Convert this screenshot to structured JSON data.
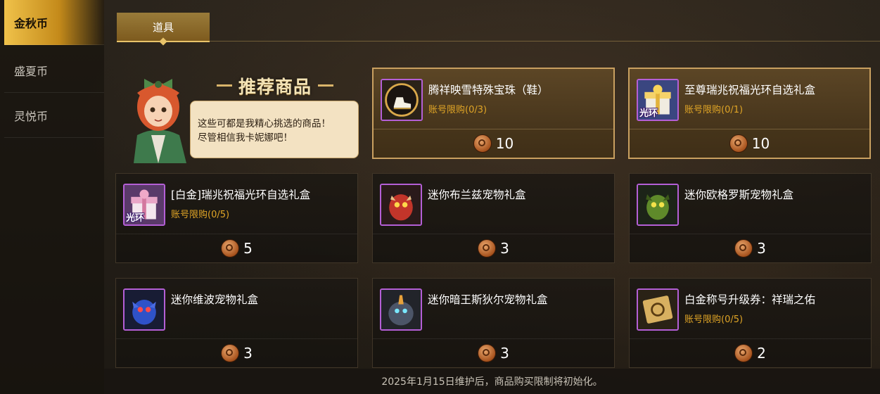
{
  "sidebar": {
    "items": [
      {
        "label": "金秋币",
        "active": true
      },
      {
        "label": "盛夏币",
        "active": false
      },
      {
        "label": "灵悦币",
        "active": false
      }
    ]
  },
  "tabs": [
    {
      "label": "道具",
      "active": true
    }
  ],
  "featured": {
    "title": "推荐商品",
    "bubble_lines": [
      "这些可都是我精心挑选的商品！",
      "尽管相信我卡妮娜吧！"
    ]
  },
  "products": [
    {
      "name": "腾祥映雪特殊宝珠（鞋）",
      "limit": "账号限购(0/3)",
      "price": "10",
      "featured": true,
      "icon": "orb-shoe-icon",
      "tag": ""
    },
    {
      "name": "至尊瑞兆祝福光环自选礼盒",
      "limit": "账号限购(0/1)",
      "price": "10",
      "featured": true,
      "icon": "gold-gift-box-icon",
      "tag": "光环"
    },
    {
      "name": "[白金]瑞兆祝福光环自选礼盒",
      "limit": "账号限购(0/5)",
      "price": "5",
      "featured": false,
      "icon": "pink-gift-box-icon",
      "tag": "光环"
    },
    {
      "name": "迷你布兰兹宠物礼盒",
      "limit": "",
      "price": "3",
      "featured": false,
      "icon": "red-dragon-pet-icon",
      "tag": ""
    },
    {
      "name": "迷你欧格罗斯宠物礼盒",
      "limit": "",
      "price": "3",
      "featured": false,
      "icon": "green-dragon-pet-icon",
      "tag": ""
    },
    {
      "name": "迷你维波宠物礼盒",
      "limit": "",
      "price": "3",
      "featured": false,
      "icon": "blue-beast-pet-icon",
      "tag": ""
    },
    {
      "name": "迷你暗王斯狄尔宠物礼盒",
      "limit": "",
      "price": "3",
      "featured": false,
      "icon": "dark-king-pet-icon",
      "tag": ""
    },
    {
      "name": "白金称号升级券：祥瑞之佑",
      "limit": "账号限购(0/5)",
      "price": "2",
      "featured": false,
      "icon": "title-ticket-icon",
      "tag": ""
    }
  ],
  "footer": {
    "notice": "2025年1月15日维护后，商品购买限制将初始化。"
  },
  "colors": {
    "accent_gold": "#e8c36a",
    "limit_orange": "#e0a526",
    "rarity_border": "#b45fd6"
  }
}
